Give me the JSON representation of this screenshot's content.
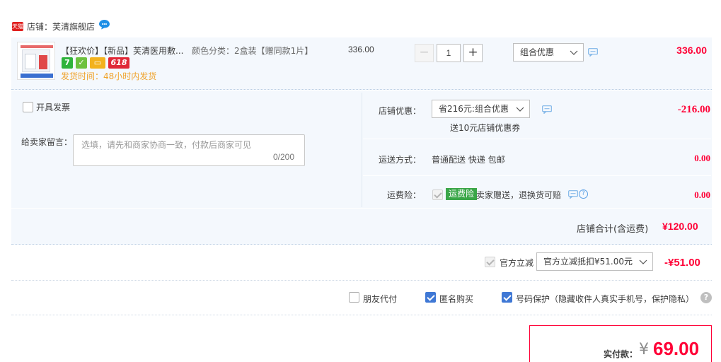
{
  "shop": {
    "badge": "天猫",
    "label": "店铺：芙清旗舰店"
  },
  "item": {
    "title": "【狂欢价】【新品】芙清医用敷...",
    "sku": "颜色分类：2盒装【赠同款1片】",
    "badges": [
      "7",
      "✓",
      "▭",
      "618"
    ],
    "ship_time": "发货时间：48小时内发货",
    "unit_price": "336.00",
    "qty_minus": "−",
    "qty": "1",
    "qty_plus": "+",
    "promo": "组合优惠",
    "total": "336.00"
  },
  "order": {
    "invoice_label": "开具发票",
    "note_label": "给卖家留言：",
    "note_placeholder": "选填，请先和商家协商一致，付款后商家可见",
    "note_count": "0/200",
    "shop_discount": {
      "label": "店铺优惠：",
      "select": "省216元:组合优惠",
      "sub": "送10元店铺优惠券",
      "value": "-216.00"
    },
    "delivery": {
      "label": "运送方式：",
      "method": "普通配送 快递 包邮",
      "value": "0.00"
    },
    "insurance": {
      "label": "运费险：",
      "tag": "运费险",
      "desc": "卖家赠送，退换货可赔",
      "value": "0.00"
    },
    "subtotal_label": "店铺合计(含运费)",
    "subtotal_value": "¥120.00"
  },
  "official": {
    "label": "官方立减",
    "select": "官方立减抵扣¥51.00元",
    "value": "-¥51.00"
  },
  "options": {
    "friend_pay": "朋友代付",
    "anonymous": "匿名购买",
    "number_protect": "号码保护（隐藏收件人真实手机号，保护隐私）",
    "help": "?"
  },
  "payment": {
    "label": "实付款：",
    "symbol": "¥",
    "amount": "69.00"
  },
  "colors": {
    "accent_red": "#ff0036",
    "check_blue": "#3f78d5",
    "panel_bg": "#f4f8fd",
    "ship_orange": "#f0a22a"
  }
}
